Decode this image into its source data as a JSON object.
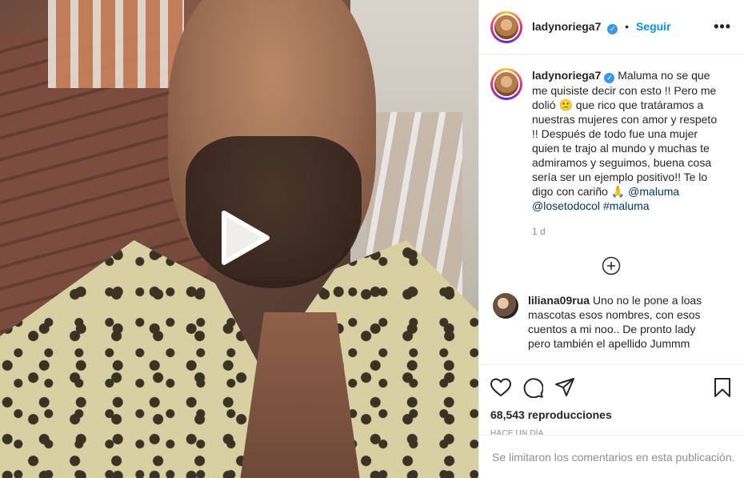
{
  "post": {
    "username": "ladynoriega7",
    "follow_label": "Seguir",
    "separator": "•",
    "more_icon": "more-horizontal-icon"
  },
  "caption": {
    "username": "ladynoriega7",
    "text_part1": "Maluma no se que me quisiste decir con esto !! Pero me dolió 🙁 que rico que tratáramos a nuestras mujeres con amor y respeto !! Después de todo fue una mujer quien te trajo al mundo y muchas te admiramos y seguimos, buena cosa sería ser un ejemplo positivo!! Te lo digo con cariño 🙏 ",
    "mention1": "@maluma",
    "mention2": "@losetodocol",
    "hashtag": "#maluma",
    "time": "1 d"
  },
  "comment": {
    "username": "liliana09rua",
    "text": "Uno no le pone a loas mascotas esos nombres, con esos cuentos a mi noo.. De pronto lady pero también el apellido Jummm"
  },
  "stats": {
    "views": "68,543 reproducciones",
    "ago": "HACE UN DÍA"
  },
  "footer": {
    "comments_closed": "Se limitaron los comentarios en esta publicación."
  },
  "icons": {
    "play": "play-icon",
    "like": "heart-icon",
    "comment": "comment-icon",
    "share": "send-icon",
    "save": "bookmark-icon",
    "load_more": "plus-circle-icon"
  },
  "colors": {
    "accent": "#0095f6",
    "verified": "#3897f0",
    "muted": "#8e8e8e",
    "hashtag": "#00376b"
  }
}
